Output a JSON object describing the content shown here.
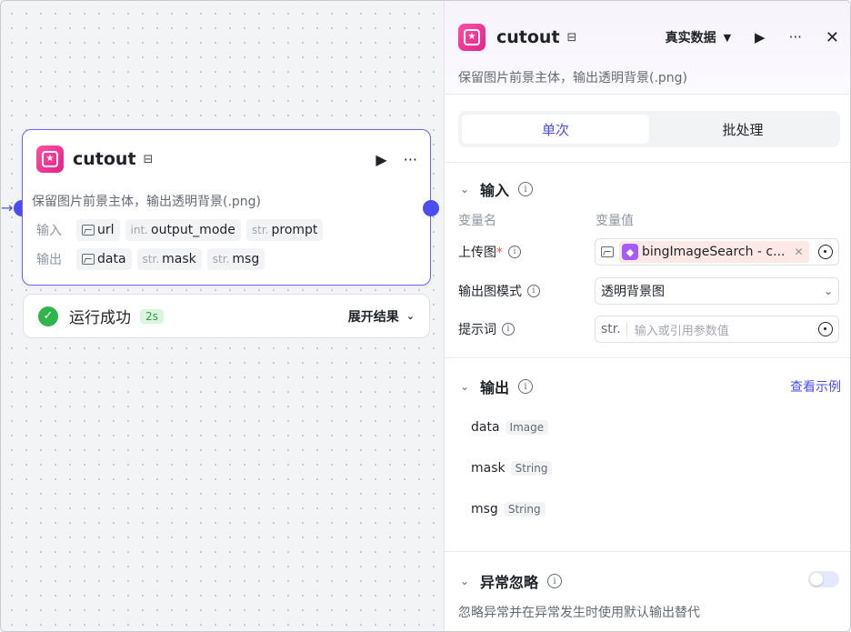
{
  "node": {
    "title": "cutout",
    "description": "保留图片前景主体，输出透明背景(.png)",
    "input_label": "输入",
    "output_label": "输出",
    "inputs": [
      {
        "type": "",
        "name": "url",
        "icon": "image-icon"
      },
      {
        "type": "int.",
        "name": "output_mode"
      },
      {
        "type": "str.",
        "name": "prompt"
      }
    ],
    "outputs": [
      {
        "type": "",
        "name": "data",
        "icon": "image-icon"
      },
      {
        "type": "str.",
        "name": "mask"
      },
      {
        "type": "str.",
        "name": "msg"
      }
    ]
  },
  "run_status": {
    "text": "运行成功",
    "duration": "2s",
    "expand_label": "展开结果"
  },
  "panel": {
    "title": "cutout",
    "mode_select": "真实数据",
    "description": "保留图片前景主体，输出透明背景(.png)",
    "tabs": [
      "单次",
      "批处理"
    ],
    "active_tab": 0,
    "input_section": {
      "title": "输入",
      "col_name": "变量名",
      "col_value": "变量值",
      "fields": {
        "upload_label": "上传图",
        "upload_required_mark": "*",
        "upload_ref": "bingImageSearch - c...",
        "mode_label": "输出图模式",
        "mode_value": "透明背景图",
        "prompt_label": "提示词",
        "prompt_type": "str.",
        "prompt_placeholder": "输入或引用参数值"
      }
    },
    "output_section": {
      "title": "输出",
      "example_link": "查看示例",
      "items": [
        {
          "name": "data",
          "type": "Image"
        },
        {
          "name": "mask",
          "type": "String"
        },
        {
          "name": "msg",
          "type": "String"
        }
      ]
    },
    "exception_section": {
      "title": "异常忽略",
      "description": "忽略异常并在异常发生时使用默认输出替代",
      "toggle_on": false
    }
  },
  "colors": {
    "accent": "#4e4df0",
    "success": "#2fb54a",
    "brand_pink": "#e0248c"
  }
}
